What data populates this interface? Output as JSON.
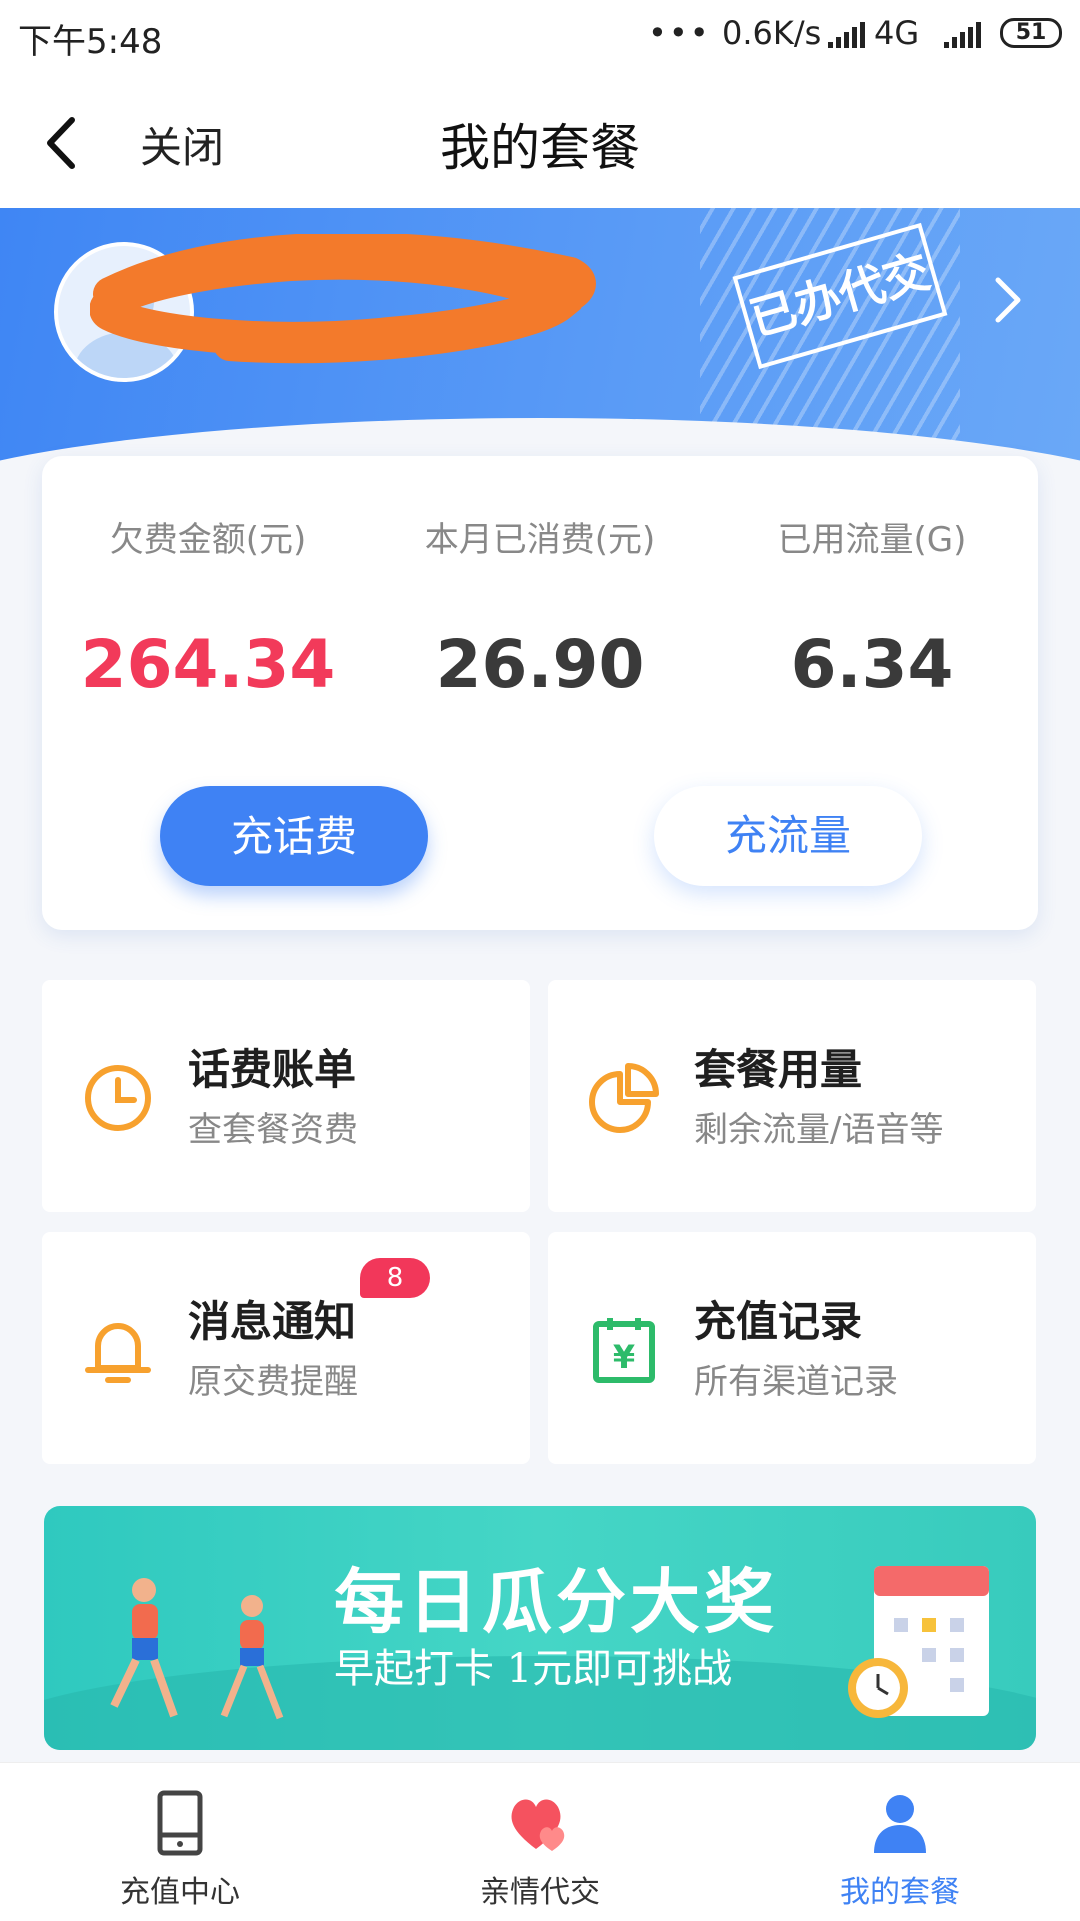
{
  "status_bar": {
    "time": "下午5:48",
    "dots": "•••",
    "speed": "0.6K/s",
    "network": "4G",
    "battery": "51"
  },
  "nav": {
    "close_label": "关闭",
    "title": "我的套餐"
  },
  "header": {
    "stamp_text": "已办代交"
  },
  "stats": [
    {
      "label": "欠费金额(元)",
      "value": "264.34"
    },
    {
      "label": "本月已消费(元)",
      "value": "26.90"
    },
    {
      "label": "已用流量(G)",
      "value": "6.34"
    }
  ],
  "actions": {
    "recharge_label": "充话费",
    "data_label": "充流量"
  },
  "tiles": [
    {
      "title": "话费账单",
      "subtitle": "查套餐资费",
      "icon": "clock-icon"
    },
    {
      "title": "套餐用量",
      "subtitle": "剩余流量/语音等",
      "icon": "pie-chart-icon"
    },
    {
      "title": "消息通知",
      "subtitle": "原交费提醒",
      "icon": "bell-icon",
      "badge": "8"
    },
    {
      "title": "充值记录",
      "subtitle": "所有渠道记录",
      "icon": "yuan-calendar-icon"
    }
  ],
  "promo": {
    "title": "每日瓜分大奖",
    "subtitle": "早起打卡  1元即可挑战"
  },
  "tabbar": [
    {
      "label": "充值中心",
      "icon": "phone-icon"
    },
    {
      "label": "亲情代交",
      "icon": "hearts-icon"
    },
    {
      "label": "我的套餐",
      "icon": "user-icon",
      "active": true
    }
  ],
  "colors": {
    "accent": "#3f82f4",
    "debt_red": "#f23a5a",
    "icon_orange": "#f7a12e",
    "icon_green": "#2dbb6a",
    "promo_teal": "#3fd1c3"
  }
}
